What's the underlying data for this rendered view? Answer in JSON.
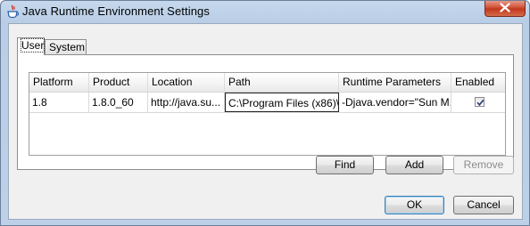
{
  "window": {
    "title": "Java Runtime Environment Settings"
  },
  "tabs": [
    {
      "label": "User",
      "selected": true
    },
    {
      "label": "System",
      "selected": false
    }
  ],
  "table": {
    "columns": [
      "Platform",
      "Product",
      "Location",
      "Path",
      "Runtime Parameters",
      "Enabled"
    ],
    "rows": [
      {
        "platform": "1.8",
        "product": "1.8.0_60",
        "location": "http://java.su...",
        "path": "C:\\Program Files (x86)\\...",
        "runtime_parameters": "-Djava.vendor=\"Sun M...",
        "enabled": true
      }
    ]
  },
  "actions": {
    "find_label": "Find",
    "add_label": "Add",
    "remove_label": "Remove"
  },
  "footer": {
    "ok_label": "OK",
    "cancel_label": "Cancel"
  },
  "icons": {
    "app": "java-icon",
    "close": "close-icon",
    "check": "checkmark-icon"
  },
  "colors": {
    "close_button": "#c2371c",
    "title_bar": "#bcd0e8",
    "default_button_border": "#3c7fb1"
  }
}
